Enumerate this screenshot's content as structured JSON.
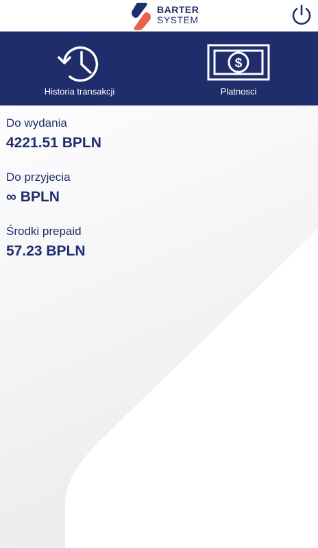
{
  "header": {
    "logo_line1": "BARTER",
    "logo_line2": "SYSTEM",
    "logo_icon": "barter-logo-mark",
    "power_icon": "power-icon"
  },
  "nav": {
    "history_label": "Historia transakcji",
    "history_icon": "history-clock-icon",
    "payments_label": "Platnosci",
    "payments_icon": "banknote-dollar-icon"
  },
  "balances": [
    {
      "label": "Do wydania",
      "value": "4221.51 BPLN"
    },
    {
      "label": "Do przyjecia",
      "value": "∞ BPLN"
    },
    {
      "label": "Środki prepaid",
      "value": "57.23 BPLN"
    }
  ],
  "colors": {
    "primary": "#1f2d6b",
    "accent": "#e8624a",
    "background": "#f2f2f4",
    "white": "#ffffff"
  }
}
